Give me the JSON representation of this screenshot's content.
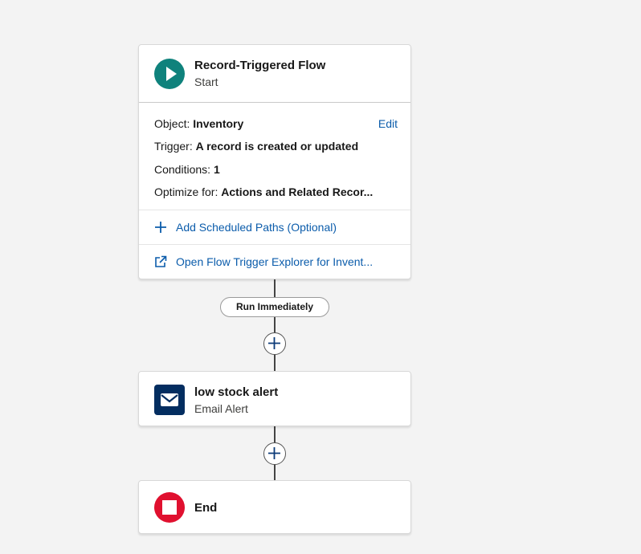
{
  "start": {
    "title": "Record-Triggered Flow",
    "subtitle": "Start",
    "object_label": "Object:",
    "object_value": "Inventory",
    "edit_label": "Edit",
    "trigger_label": "Trigger:",
    "trigger_value": "A record is created or updated",
    "conditions_label": "Conditions:",
    "conditions_value": "1",
    "optimize_label": "Optimize for:",
    "optimize_value": "Actions and Related Recor...",
    "add_paths_label": "Add Scheduled Paths (Optional)",
    "explorer_label": "Open Flow Trigger Explorer for Invent..."
  },
  "path_label": "Run Immediately",
  "email_alert": {
    "title": "low stock alert",
    "subtitle": "Email Alert"
  },
  "end": {
    "title": "End"
  },
  "icons": {
    "start": "play-icon",
    "email": "envelope-icon",
    "end": "stop-icon",
    "add": "plus-icon",
    "external": "external-link-icon"
  },
  "colors": {
    "start_icon": "#0f827c",
    "email_icon": "#032d60",
    "end_icon": "#e0102f",
    "link": "#0b5cab"
  }
}
